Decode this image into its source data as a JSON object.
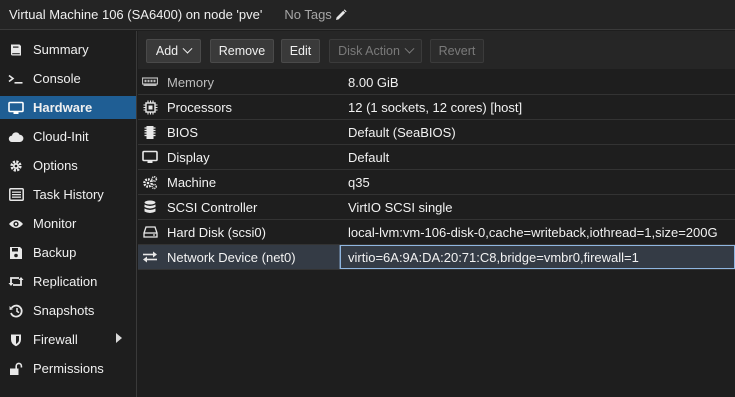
{
  "header": {
    "title": "Virtual Machine 106 (SA6400) on node 'pve'",
    "tags_label": "No Tags"
  },
  "sidebar": {
    "items": [
      {
        "label": "Summary",
        "icon": "book-icon"
      },
      {
        "label": "Console",
        "icon": "terminal-icon"
      },
      {
        "label": "Hardware",
        "icon": "desktop-icon",
        "active": true
      },
      {
        "label": "Cloud-Init",
        "icon": "cloud-icon"
      },
      {
        "label": "Options",
        "icon": "gear-icon"
      },
      {
        "label": "Task History",
        "icon": "list-icon"
      },
      {
        "label": "Monitor",
        "icon": "eye-icon"
      },
      {
        "label": "Backup",
        "icon": "floppy-icon"
      },
      {
        "label": "Replication",
        "icon": "retweet-icon"
      },
      {
        "label": "Snapshots",
        "icon": "history-icon"
      },
      {
        "label": "Firewall",
        "icon": "shield-icon"
      },
      {
        "label": "Permissions",
        "icon": "unlock-icon"
      }
    ]
  },
  "toolbar": {
    "add_label": "Add",
    "remove_label": "Remove",
    "edit_label": "Edit",
    "disk_action_label": "Disk Action",
    "revert_label": "Revert"
  },
  "hardware": {
    "rows": [
      {
        "key": "Memory",
        "value": "8.00 GiB",
        "icon": "memory-icon"
      },
      {
        "key": "Processors",
        "value": "12 (1 sockets, 12 cores) [host]",
        "icon": "cpu-icon"
      },
      {
        "key": "BIOS",
        "value": "Default (SeaBIOS)",
        "icon": "microchip-icon"
      },
      {
        "key": "Display",
        "value": "Default",
        "icon": "desktop-icon"
      },
      {
        "key": "Machine",
        "value": "q35",
        "icon": "cogs-icon"
      },
      {
        "key": "SCSI Controller",
        "value": "VirtIO SCSI single",
        "icon": "database-icon"
      },
      {
        "key": "Hard Disk (scsi0)",
        "value": "local-lvm:vm-106-disk-0,cache=writeback,iothread=1,size=200G",
        "icon": "hdd-icon"
      },
      {
        "key": "Network Device (net0)",
        "value": "virtio=6A:9A:DA:20:71:C8,bridge=vmbr0,firewall=1",
        "icon": "exchange-icon"
      }
    ]
  },
  "colors": {
    "active_nav": "#1f5e94",
    "selected_row": "#343b45",
    "selected_border": "#8fb6e0"
  }
}
